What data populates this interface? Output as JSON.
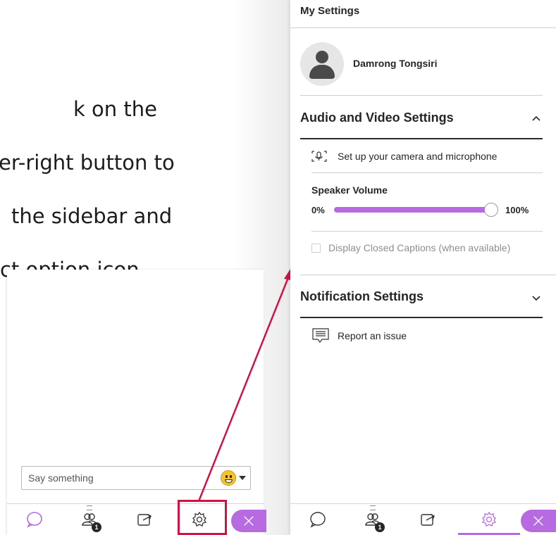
{
  "instruction": {
    "line1": "k on the",
    "line2": "er-right button to",
    "line3": "the sidebar and",
    "line4": "ct option icon"
  },
  "mini_panel": {
    "chat_placeholder": "Say something",
    "participant_count": "1"
  },
  "settings_panel": {
    "title": "My Settings",
    "user_name": "Damrong Tongsiri",
    "audio_video": {
      "title": "Audio and Video Settings",
      "setup_label": "Set up your camera and microphone",
      "speaker_volume_label": "Speaker Volume",
      "min_label": "0%",
      "max_label": "100%",
      "volume_level": 1.0,
      "captions_label": "Display Closed Captions (when available)",
      "captions_checked": false
    },
    "notification": {
      "title": "Notification Settings"
    },
    "report_label": "Report an issue",
    "participant_count": "1"
  },
  "colors": {
    "accent": "#b86ae0",
    "highlight": "#d01245",
    "text": "#262626"
  },
  "icons": [
    "chat-icon",
    "participants-icon",
    "share-icon",
    "gear-icon",
    "close-icon",
    "camera-mic-icon",
    "report-icon",
    "chevron-up-icon",
    "chevron-down-icon",
    "emoji-icon"
  ]
}
